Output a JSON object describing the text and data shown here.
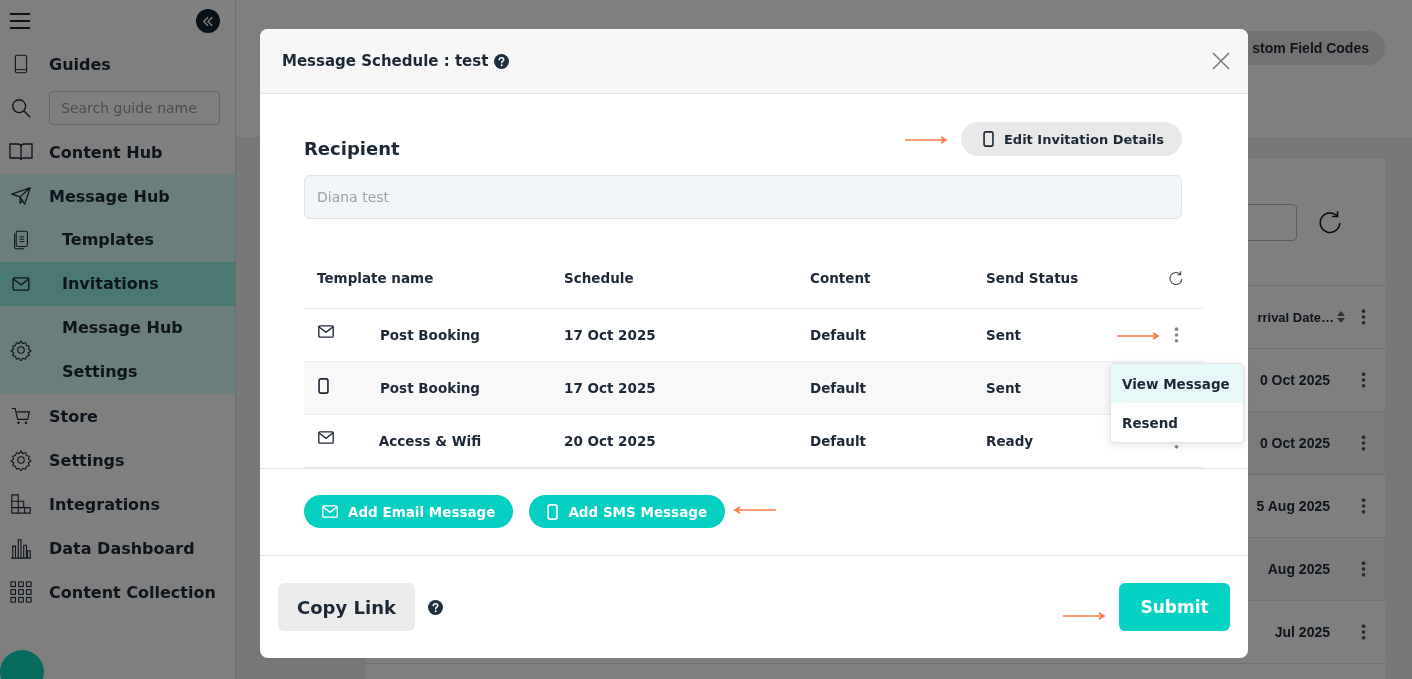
{
  "sidebar": {
    "items": [
      {
        "kind": "link",
        "label": "Guides"
      },
      {
        "kind": "search",
        "placeholder": "Search guide name"
      },
      {
        "kind": "link",
        "label": "Content Hub"
      },
      {
        "kind": "link",
        "label": "Message Hub",
        "expanded": true,
        "children": [
          {
            "lines": [
              "Templates"
            ],
            "selected": false
          },
          {
            "lines": [
              "Invitations"
            ],
            "selected": true
          },
          {
            "lines": [
              "Message Hub",
              "Settings"
            ],
            "selected": false
          }
        ]
      },
      {
        "kind": "link",
        "label": "Store"
      },
      {
        "kind": "link",
        "label": "Settings"
      },
      {
        "kind": "link",
        "label": "Integrations"
      },
      {
        "kind": "link",
        "label": "Data Dashboard"
      },
      {
        "kind": "link",
        "label": "Content Collection"
      }
    ]
  },
  "background": {
    "header_button": "stom Field Codes",
    "table": {
      "column": "rrival Date…",
      "rows": [
        "0 Oct 2025",
        "0 Oct 2025",
        "5 Aug 2025",
        "Aug 2025",
        "Jul 2025"
      ]
    }
  },
  "modal": {
    "title": "Message Schedule : test",
    "recipient": {
      "label": "Recipient",
      "value": "Diana test",
      "disabled": true,
      "edit_button": "Edit Invitation Details"
    },
    "table": {
      "columns": [
        "Template name",
        "Schedule",
        "Content",
        "Send Status"
      ],
      "rows": [
        {
          "kind": "email",
          "name": "Post Booking",
          "schedule": "17 Oct 2025",
          "content": "Default",
          "status": "Sent"
        },
        {
          "kind": "sms",
          "name": "Post Booking",
          "schedule": "17 Oct 2025",
          "content": "Default",
          "status": "Sent"
        },
        {
          "kind": "email",
          "name": "Access & Wifi",
          "schedule": "20 Oct 2025",
          "content": "Default",
          "status": "Ready"
        }
      ]
    },
    "row_menu": {
      "items": [
        {
          "label": "View Message",
          "highlighted": true
        },
        {
          "label": "Resend",
          "highlighted": false
        }
      ]
    },
    "add_buttons": [
      {
        "kind": "email",
        "label": "Add Email Message"
      },
      {
        "kind": "sms",
        "label": "Add SMS Message"
      }
    ],
    "copy_link": "Copy Link",
    "submit": "Submit"
  }
}
